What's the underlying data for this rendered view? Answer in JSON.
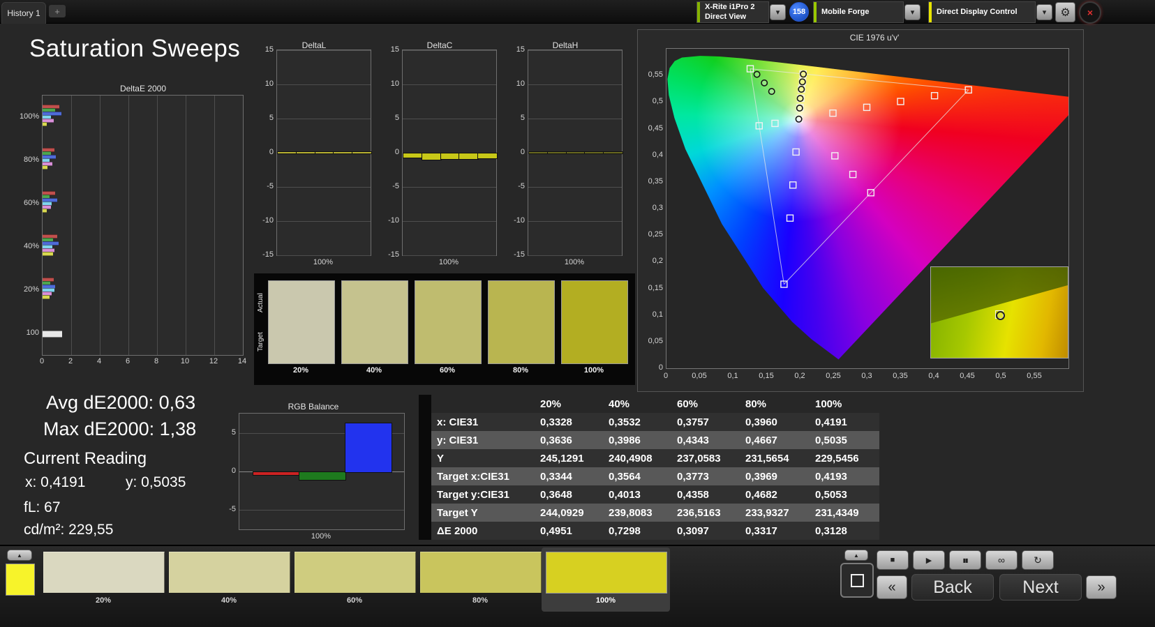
{
  "topbar": {
    "history_tab": "History 1",
    "add_tab": "+",
    "meter_line1": "X-Rite i1Pro 2",
    "meter_line2": "Direct View",
    "reading_count": "158",
    "source": "Mobile Forge",
    "display_control": "Direct Display Control",
    "chevron": "▾",
    "gear": "⚙",
    "close": "×",
    "meter_stripe_color": "#86b300",
    "source_stripe_color": "#9ac800",
    "control_stripe_color": "#e8e400"
  },
  "page_title": "Saturation Sweeps",
  "stats": {
    "avg": "Avg dE2000: 0,63",
    "max": "Max dE2000: 1,38",
    "current_reading": "Current Reading",
    "x": "x: 0,4191",
    "y": "y: 0,5035",
    "fl": "fL: 67",
    "cdm2": "cd/m²: 229,55"
  },
  "swatch_panel": {
    "actual_label": "Actual",
    "target_label": "Target",
    "items": [
      {
        "label": "20%",
        "color": "#cac8ae"
      },
      {
        "label": "40%",
        "color": "#c5c28e"
      },
      {
        "label": "60%",
        "color": "#bfbc6f"
      },
      {
        "label": "80%",
        "color": "#b9b550"
      },
      {
        "label": "100%",
        "color": "#b3ae22"
      }
    ]
  },
  "table": {
    "headers": [
      "",
      "20%",
      "40%",
      "60%",
      "80%",
      "100%"
    ],
    "rows": [
      {
        "label": "x: CIE31",
        "values": [
          "0,3328",
          "0,3532",
          "0,3757",
          "0,3960",
          "0,4191"
        ]
      },
      {
        "label": "y: CIE31",
        "values": [
          "0,3636",
          "0,3986",
          "0,4343",
          "0,4667",
          "0,5035"
        ]
      },
      {
        "label": "Y",
        "values": [
          "245,1291",
          "240,4908",
          "237,0583",
          "231,5654",
          "229,5456"
        ]
      },
      {
        "label": "Target x:CIE31",
        "values": [
          "0,3344",
          "0,3564",
          "0,3773",
          "0,3969",
          "0,4193"
        ]
      },
      {
        "label": "Target y:CIE31",
        "values": [
          "0,3648",
          "0,4013",
          "0,4358",
          "0,4682",
          "0,5053"
        ]
      },
      {
        "label": "Target Y",
        "values": [
          "244,0929",
          "239,8083",
          "236,5163",
          "233,9327",
          "231,4349"
        ]
      },
      {
        "label": "ΔE 2000",
        "values": [
          "0,4951",
          "0,7298",
          "0,3097",
          "0,3317",
          "0,3128"
        ]
      }
    ]
  },
  "bottom_bar": {
    "pattern_color": "#f7f32a",
    "up_icon": "▲",
    "items": [
      {
        "label": "20%",
        "color": "#dad8c0",
        "selected": false
      },
      {
        "label": "40%",
        "color": "#d5d29f",
        "selected": false
      },
      {
        "label": "60%",
        "color": "#cfcc7f",
        "selected": false
      },
      {
        "label": "80%",
        "color": "#c9c55d",
        "selected": false
      },
      {
        "label": "100%",
        "color": "#d7d021",
        "selected": true
      }
    ],
    "controls": {
      "stop": "■",
      "play": "▶",
      "pause": "▮▮",
      "loop": "∞",
      "refresh": "↻",
      "prev": "«",
      "next_arrow": "»",
      "back_label": "Back",
      "next_label": "Next"
    }
  },
  "chart_data": [
    {
      "id": "deltae2000",
      "type": "bar",
      "orientation": "horizontal",
      "title": "DeltaE 2000",
      "xlim": [
        0,
        14
      ],
      "x_ticks": [
        0,
        2,
        4,
        6,
        8,
        10,
        12,
        14
      ],
      "groups": [
        "100%",
        "80%",
        "60%",
        "40%",
        "20%",
        "100"
      ],
      "series": [
        {
          "name": "red",
          "color": "#c0504d",
          "values": [
            1.15,
            0.85,
            0.9,
            1.0,
            0.8,
            null
          ]
        },
        {
          "name": "green",
          "color": "#4ea64e",
          "values": [
            0.9,
            0.6,
            0.5,
            0.75,
            0.55,
            null
          ]
        },
        {
          "name": "blue",
          "color": "#4f6bd8",
          "values": [
            1.3,
            0.95,
            1.0,
            1.1,
            0.9,
            null
          ]
        },
        {
          "name": "cyan",
          "color": "#7fd4ee",
          "values": [
            0.6,
            0.5,
            0.65,
            0.7,
            0.85,
            null
          ]
        },
        {
          "name": "magenta",
          "color": "#d88fd8",
          "values": [
            0.8,
            0.7,
            0.6,
            0.85,
            0.65,
            null
          ]
        },
        {
          "name": "yellow",
          "color": "#d8d84f",
          "values": [
            0.3128,
            0.3317,
            0.3097,
            0.7298,
            0.4951,
            null
          ]
        },
        {
          "name": "white",
          "color": "#e8e8e8",
          "values": [
            null,
            null,
            null,
            null,
            null,
            1.38
          ]
        }
      ]
    },
    {
      "id": "deltaL",
      "type": "bar",
      "title": "DeltaL",
      "ylim": [
        -15,
        15
      ],
      "y_ticks": [
        15,
        10,
        5,
        0,
        -5,
        -10,
        -15
      ],
      "categories": [
        "20%",
        "40%",
        "60%",
        "80%",
        "100%"
      ],
      "values": [
        0.15,
        0.1,
        0.1,
        0.1,
        0.1
      ],
      "bar_color": "#b8b232",
      "x_axis_label": "100%"
    },
    {
      "id": "deltaC",
      "type": "bar",
      "title": "DeltaC",
      "ylim": [
        -15,
        15
      ],
      "y_ticks": [
        15,
        10,
        5,
        0,
        -5,
        -10,
        -15
      ],
      "categories": [
        "20%",
        "40%",
        "60%",
        "80%",
        "100%"
      ],
      "values": [
        -0.6,
        -0.9,
        -0.8,
        -0.8,
        -0.7
      ],
      "bar_color": "#c8c818",
      "x_axis_label": "100%"
    },
    {
      "id": "deltaH",
      "type": "bar",
      "title": "DeltaH",
      "ylim": [
        -15,
        15
      ],
      "y_ticks": [
        15,
        10,
        5,
        0,
        -5,
        -10,
        -15
      ],
      "categories": [
        "20%",
        "40%",
        "60%",
        "80%",
        "100%"
      ],
      "values": [
        0.2,
        0.15,
        0.1,
        0.1,
        0.1
      ],
      "bar_color": "#6a6a20",
      "x_axis_label": "100%"
    },
    {
      "id": "rgb_balance",
      "type": "bar",
      "title": "RGB Balance",
      "ylim": [
        -7.5,
        7.5
      ],
      "y_ticks": [
        5,
        0,
        -5
      ],
      "categories": [
        "R",
        "G",
        "B"
      ],
      "values": [
        -0.4,
        -1.0,
        6.3
      ],
      "colors": [
        "#cc2222",
        "#1e7a1e",
        "#2233ee"
      ],
      "x_axis_label": "100%"
    },
    {
      "id": "cie",
      "type": "scatter",
      "title": "CIE 1976 u'v'",
      "xlim": [
        0,
        0.6
      ],
      "ylim": [
        0,
        0.6
      ],
      "x_ticks": [
        "0",
        "0,05",
        "0,1",
        "0,15",
        "0,2",
        "0,25",
        "0,3",
        "0,35",
        "0,4",
        "0,45",
        "0,5",
        "0,55"
      ],
      "y_ticks": [
        "0",
        "0,05",
        "0,1",
        "0,15",
        "0,2",
        "0,25",
        "0,3",
        "0,35",
        "0,4",
        "0,45",
        "0,5",
        "0,55"
      ],
      "gamut_triangle_uv": [
        [
          0.125,
          0.5625
        ],
        [
          0.4507,
          0.5229
        ],
        [
          0.1754,
          0.1579
        ]
      ],
      "targets_uv": [
        [
          0.1978,
          0.4683
        ],
        [
          0.1994,
          0.4894
        ],
        [
          0.2005,
          0.5073
        ],
        [
          0.2017,
          0.5245
        ],
        [
          0.203,
          0.5385
        ],
        [
          0.2039,
          0.5529
        ],
        [
          0.125,
          0.5625
        ],
        [
          0.162,
          0.46
        ],
        [
          0.1383,
          0.4554
        ],
        [
          0.2484,
          0.4792
        ],
        [
          0.299,
          0.4901
        ],
        [
          0.3495,
          0.5011
        ],
        [
          0.4001,
          0.512
        ],
        [
          0.4507,
          0.5229
        ],
        [
          0.2514,
          0.399
        ],
        [
          0.2782,
          0.364
        ],
        [
          0.305,
          0.3297
        ],
        [
          0.1933,
          0.4062
        ],
        [
          0.1888,
          0.3441
        ],
        [
          0.1844,
          0.2821
        ],
        [
          0.1754,
          0.1579
        ]
      ],
      "measurements_uv": [
        [
          0.1988,
          0.4886
        ],
        [
          0.1996,
          0.5069
        ],
        [
          0.2014,
          0.524
        ],
        [
          0.2029,
          0.5379
        ],
        [
          0.2043,
          0.5524
        ],
        [
          0.1975,
          0.468
        ],
        [
          0.135,
          0.552
        ],
        [
          0.146,
          0.536
        ],
        [
          0.157,
          0.52
        ]
      ]
    }
  ]
}
